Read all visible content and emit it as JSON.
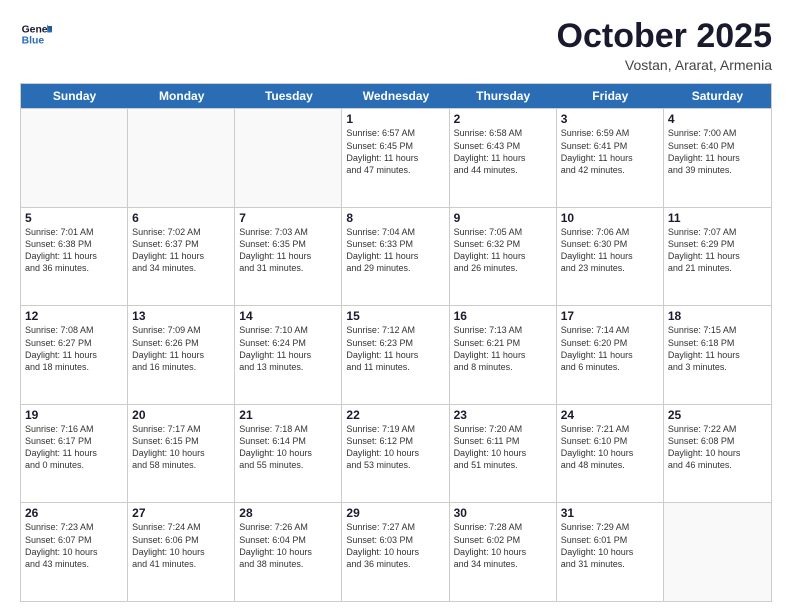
{
  "header": {
    "logo_line1": "General",
    "logo_line2": "Blue",
    "month_title": "October 2025",
    "location": "Vostan, Ararat, Armenia"
  },
  "calendar": {
    "days_of_week": [
      "Sunday",
      "Monday",
      "Tuesday",
      "Wednesday",
      "Thursday",
      "Friday",
      "Saturday"
    ],
    "rows": [
      [
        {
          "day": "",
          "empty": true
        },
        {
          "day": "",
          "empty": true
        },
        {
          "day": "",
          "empty": true
        },
        {
          "day": "1",
          "info": "Sunrise: 6:57 AM\nSunset: 6:45 PM\nDaylight: 11 hours\nand 47 minutes."
        },
        {
          "day": "2",
          "info": "Sunrise: 6:58 AM\nSunset: 6:43 PM\nDaylight: 11 hours\nand 44 minutes."
        },
        {
          "day": "3",
          "info": "Sunrise: 6:59 AM\nSunset: 6:41 PM\nDaylight: 11 hours\nand 42 minutes."
        },
        {
          "day": "4",
          "info": "Sunrise: 7:00 AM\nSunset: 6:40 PM\nDaylight: 11 hours\nand 39 minutes."
        }
      ],
      [
        {
          "day": "5",
          "info": "Sunrise: 7:01 AM\nSunset: 6:38 PM\nDaylight: 11 hours\nand 36 minutes."
        },
        {
          "day": "6",
          "info": "Sunrise: 7:02 AM\nSunset: 6:37 PM\nDaylight: 11 hours\nand 34 minutes."
        },
        {
          "day": "7",
          "info": "Sunrise: 7:03 AM\nSunset: 6:35 PM\nDaylight: 11 hours\nand 31 minutes."
        },
        {
          "day": "8",
          "info": "Sunrise: 7:04 AM\nSunset: 6:33 PM\nDaylight: 11 hours\nand 29 minutes."
        },
        {
          "day": "9",
          "info": "Sunrise: 7:05 AM\nSunset: 6:32 PM\nDaylight: 11 hours\nand 26 minutes."
        },
        {
          "day": "10",
          "info": "Sunrise: 7:06 AM\nSunset: 6:30 PM\nDaylight: 11 hours\nand 23 minutes."
        },
        {
          "day": "11",
          "info": "Sunrise: 7:07 AM\nSunset: 6:29 PM\nDaylight: 11 hours\nand 21 minutes."
        }
      ],
      [
        {
          "day": "12",
          "info": "Sunrise: 7:08 AM\nSunset: 6:27 PM\nDaylight: 11 hours\nand 18 minutes."
        },
        {
          "day": "13",
          "info": "Sunrise: 7:09 AM\nSunset: 6:26 PM\nDaylight: 11 hours\nand 16 minutes."
        },
        {
          "day": "14",
          "info": "Sunrise: 7:10 AM\nSunset: 6:24 PM\nDaylight: 11 hours\nand 13 minutes."
        },
        {
          "day": "15",
          "info": "Sunrise: 7:12 AM\nSunset: 6:23 PM\nDaylight: 11 hours\nand 11 minutes."
        },
        {
          "day": "16",
          "info": "Sunrise: 7:13 AM\nSunset: 6:21 PM\nDaylight: 11 hours\nand 8 minutes."
        },
        {
          "day": "17",
          "info": "Sunrise: 7:14 AM\nSunset: 6:20 PM\nDaylight: 11 hours\nand 6 minutes."
        },
        {
          "day": "18",
          "info": "Sunrise: 7:15 AM\nSunset: 6:18 PM\nDaylight: 11 hours\nand 3 minutes."
        }
      ],
      [
        {
          "day": "19",
          "info": "Sunrise: 7:16 AM\nSunset: 6:17 PM\nDaylight: 11 hours\nand 0 minutes."
        },
        {
          "day": "20",
          "info": "Sunrise: 7:17 AM\nSunset: 6:15 PM\nDaylight: 10 hours\nand 58 minutes."
        },
        {
          "day": "21",
          "info": "Sunrise: 7:18 AM\nSunset: 6:14 PM\nDaylight: 10 hours\nand 55 minutes."
        },
        {
          "day": "22",
          "info": "Sunrise: 7:19 AM\nSunset: 6:12 PM\nDaylight: 10 hours\nand 53 minutes."
        },
        {
          "day": "23",
          "info": "Sunrise: 7:20 AM\nSunset: 6:11 PM\nDaylight: 10 hours\nand 51 minutes."
        },
        {
          "day": "24",
          "info": "Sunrise: 7:21 AM\nSunset: 6:10 PM\nDaylight: 10 hours\nand 48 minutes."
        },
        {
          "day": "25",
          "info": "Sunrise: 7:22 AM\nSunset: 6:08 PM\nDaylight: 10 hours\nand 46 minutes."
        }
      ],
      [
        {
          "day": "26",
          "info": "Sunrise: 7:23 AM\nSunset: 6:07 PM\nDaylight: 10 hours\nand 43 minutes."
        },
        {
          "day": "27",
          "info": "Sunrise: 7:24 AM\nSunset: 6:06 PM\nDaylight: 10 hours\nand 41 minutes."
        },
        {
          "day": "28",
          "info": "Sunrise: 7:26 AM\nSunset: 6:04 PM\nDaylight: 10 hours\nand 38 minutes."
        },
        {
          "day": "29",
          "info": "Sunrise: 7:27 AM\nSunset: 6:03 PM\nDaylight: 10 hours\nand 36 minutes."
        },
        {
          "day": "30",
          "info": "Sunrise: 7:28 AM\nSunset: 6:02 PM\nDaylight: 10 hours\nand 34 minutes."
        },
        {
          "day": "31",
          "info": "Sunrise: 7:29 AM\nSunset: 6:01 PM\nDaylight: 10 hours\nand 31 minutes."
        },
        {
          "day": "",
          "empty": true
        }
      ]
    ]
  }
}
